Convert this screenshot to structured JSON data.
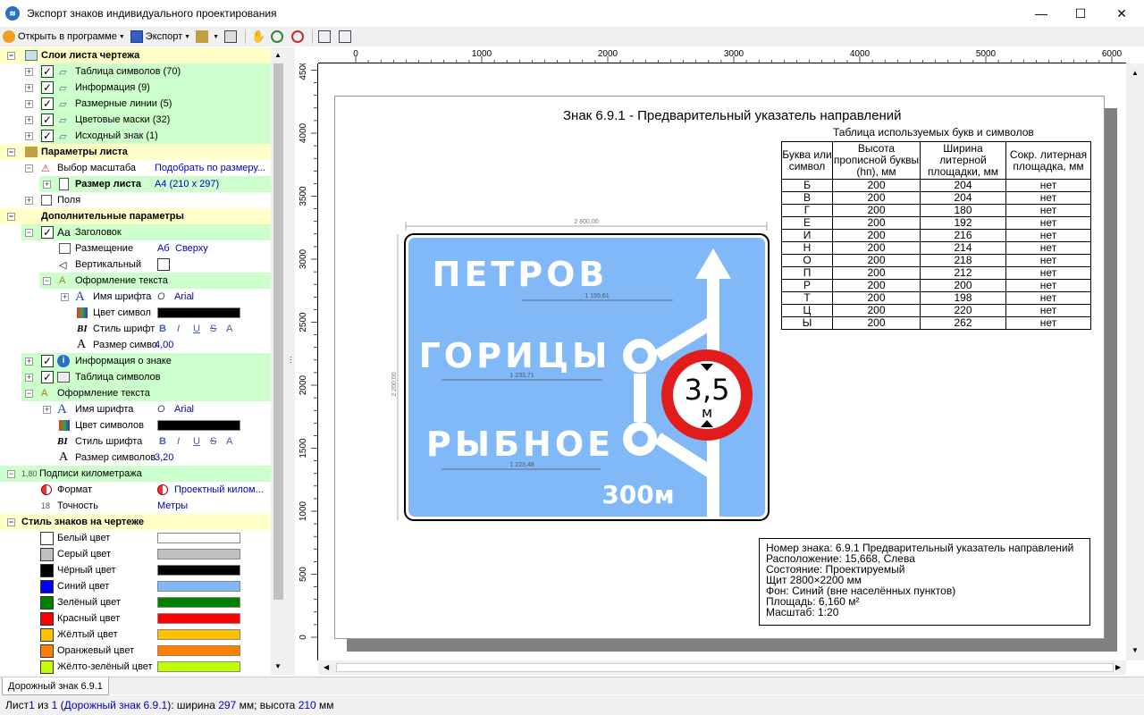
{
  "window": {
    "title": "Экспорт знаков индивидуального проектирования"
  },
  "toolbar": {
    "open_label": "Открыть в программе",
    "export_label": "Экспорт"
  },
  "tree": {
    "layers_section": "Слои листа чертежа",
    "layers": [
      "Таблица символов (70)",
      "Информация (9)",
      "Размерные линии (5)",
      "Цветовые маски (32)",
      "Исходный знак (1)"
    ],
    "sheet_section": "Параметры листа",
    "scale_label": "Выбор масштаба",
    "scale_value": "Подобрать по размеру...",
    "size_label": "Размер листа",
    "size_value": "А4 (210 x 297)",
    "fields_label": "Поля",
    "extra_section": "Дополнительные параметры",
    "header_label": "Заголовок",
    "placement_label": "Размещение",
    "placement_value": "Сверху",
    "vertical_label": "Вертикальный",
    "text_format_label": "Оформление текста",
    "font_name_label": "Имя шрифта",
    "font_name_value": "Arial",
    "sym_color_label1": "Цвет символ",
    "font_style_label1": "Стиль шрифт",
    "sym_size_label1": "Размер симво.",
    "sym_size_value1": "4,00",
    "sign_info_label": "Информация о знаке",
    "sym_table_label": "Таблица символов",
    "text_format_label2": "Оформление текста",
    "font_name_label2": "Имя шрифта",
    "font_name_value2": "Arial",
    "sym_color_label2": "Цвет символов",
    "font_style_label2": "Стиль шрифта",
    "sym_size_label2": "Размер символов",
    "sym_size_value2": "3,20",
    "km_section": "Подписи километража",
    "format_label": "Формат",
    "format_value": "Проектный килом...",
    "accuracy_label": "Точность",
    "accuracy_value": "Метры",
    "style_section": "Стиль знаков на чертеже",
    "colors": [
      {
        "name": "Белый цвет",
        "hex": "#ffffff",
        "bar": "#ffffff"
      },
      {
        "name": "Серый цвет",
        "hex": "#c0c0c0",
        "bar": "#c0c0c0"
      },
      {
        "name": "Чёрный цвет",
        "hex": "#000000",
        "bar": "#000000"
      },
      {
        "name": "Синий цвет",
        "hex": "#0000ff",
        "bar": "#80b8f8"
      },
      {
        "name": "Зелёный цвет",
        "hex": "#008000",
        "bar": "#008000"
      },
      {
        "name": "Красный цвет",
        "hex": "#ff0000",
        "bar": "#ff0000"
      },
      {
        "name": "Жёлтый цвет",
        "hex": "#ffc000",
        "bar": "#ffc000"
      },
      {
        "name": "Оранжевый цвет",
        "hex": "#ff8000",
        "bar": "#ff8000"
      },
      {
        "name": "Жёлто-зелёный цвет",
        "hex": "#c0ff00",
        "bar": "#c0ff00"
      }
    ]
  },
  "ruler": {
    "top": [
      "0",
      "1000",
      "2000",
      "3000",
      "4000",
      "5000",
      "6000"
    ],
    "left": [
      "4500",
      "4000",
      "3500",
      "3000",
      "2500",
      "2000",
      "1500",
      "1000",
      "500",
      "0"
    ]
  },
  "sheet": {
    "sign_title": "Знак 6.9.1 - Предварительный указатель направлений",
    "table_title": "Таблица используемых букв и символов",
    "table_headers": [
      "Буква или символ",
      "Высота прописной буквы (hп), мм",
      "Ширина литерной площадки, мм",
      "Сокр. литерная площадка, мм"
    ],
    "table_rows": [
      [
        "Б",
        "200",
        "204",
        "нет"
      ],
      [
        "В",
        "200",
        "204",
        "нет"
      ],
      [
        "Г",
        "200",
        "180",
        "нет"
      ],
      [
        "Е",
        "200",
        "192",
        "нет"
      ],
      [
        "И",
        "200",
        "216",
        "нет"
      ],
      [
        "Н",
        "200",
        "214",
        "нет"
      ],
      [
        "О",
        "200",
        "218",
        "нет"
      ],
      [
        "П",
        "200",
        "212",
        "нет"
      ],
      [
        "Р",
        "200",
        "200",
        "нет"
      ],
      [
        "Т",
        "200",
        "198",
        "нет"
      ],
      [
        "Ц",
        "200",
        "220",
        "нет"
      ],
      [
        "Ы",
        "200",
        "262",
        "нет"
      ]
    ],
    "sign": {
      "width_dim": "2 800,00",
      "height_dim": "2 200,00",
      "dest1": "ПЕТРОВ",
      "dest1_dim": "1 155,61",
      "dest2": "ГОРИЦЫ",
      "dest2_dim": "1 233,71",
      "dest3": "РЫБНОЕ",
      "dest3_dim": "1 223,48",
      "distance": "300м",
      "limit_value": "3,5",
      "limit_unit": "м",
      "bg_color": "#80b8f8"
    },
    "info_lines": [
      "Номер знака: 6.9.1 Предварительный указатель направлений",
      "Расположение: 15,668, Слева",
      "Состояние: Проектируемый",
      "Щит 2800×2200 мм",
      "Фон: Синий (вне населённых пунктов)",
      "Площадь: 6,160 м²",
      "Масштаб: 1:20"
    ]
  },
  "tab": {
    "label": "Дорожный знак 6.9.1"
  },
  "status": {
    "p1": "Лист ",
    "sheet_num": "1",
    "p2": " из ",
    "sheet_total": "1",
    "p3": " (",
    "sheet_name": "Дорожный знак 6.9.1",
    "p4": "): ширина ",
    "width": "297",
    "p5": " мм; высота ",
    "height": "210",
    "p6": " мм"
  }
}
